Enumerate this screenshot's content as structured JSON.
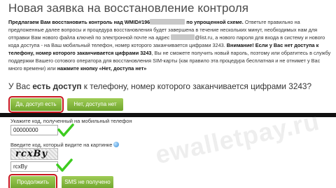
{
  "page": {
    "title": "Новая заявка на восстановление контроля"
  },
  "intro": {
    "p1_bold": "Предлагаем Вам восстановить контроль над WMID#196",
    "p1_bold_tail": "по упрощенной схеме.",
    "p2": "Ответьте правильно на предложенные далее вопросы и процедура восстановления будет завершена в течение нескольких минут, необходимых нам для отправки Вам нового файла ключей по электронной почте на адрес ",
    "email_tail": "@list.ru",
    "p3": ", а нового пароля для входа в систему и нового кода доступа - на Ваш мобильный телефон, номер которого заканчивается цифрами 3243.",
    "warning_bold": "Внимание! Если у Вас нет доступа к телефону, номер которого заканчивается цифрами 3243",
    "p4": ", Вы не сможете получить новый пароль, поэтому или обратитесь в службу поддержки Вашего сотового оператора для восстановления SIM-карты (как правило эта процедура бесплатная и не отнимет у Вас много времени) или ",
    "press_bold": "нажмите кнопку «Нет, доступа нет»"
  },
  "question": {
    "pre": "У Вас ",
    "bold": "есть доступ",
    "post": " к телефону, номер которого заканчивается цифрами 3243?"
  },
  "buttons": {
    "yes": "Да, доступ есть",
    "no": "Нет, доступа нет",
    "continue": "Продолжить",
    "sms": "SMS не получено"
  },
  "form": {
    "phone_code_label": "Укажите код, полученный на мобильный телефон",
    "phone_code_value": "00000000",
    "captcha_label": "Введите код, который видите на картинке",
    "captcha_text": "rcxBy",
    "captcha_value": "rcxBy"
  },
  "watermark": "ewalletpay.ru",
  "colors": {
    "green_button": "#7fb33a",
    "highlight_red": "#c8161d",
    "check_green": "#3dcc1f"
  }
}
